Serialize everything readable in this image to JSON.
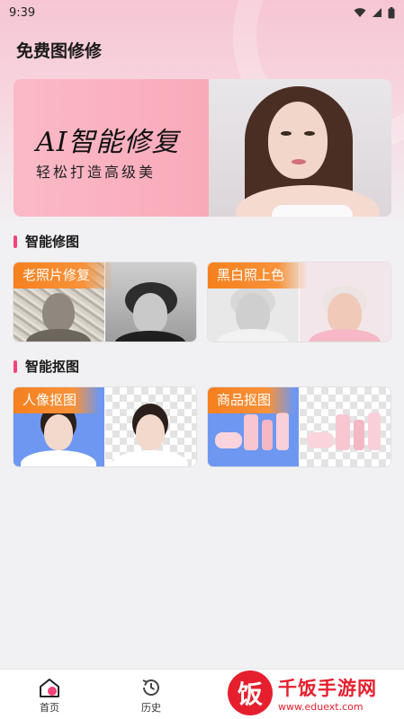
{
  "status_bar": {
    "time": "9:39"
  },
  "app_title": "免费图修修",
  "banner": {
    "title": "AI智能修复",
    "subtitle": "轻松打造高级美"
  },
  "sections": [
    {
      "title": "智能修图",
      "cards": [
        {
          "label": "老照片修复"
        },
        {
          "label": "黑白照上色"
        }
      ]
    },
    {
      "title": "智能抠图",
      "cards": [
        {
          "label": "人像抠图"
        },
        {
          "label": "商品抠图"
        }
      ]
    }
  ],
  "bottom_nav": [
    {
      "label": "首页",
      "icon": "home-icon",
      "active": true
    },
    {
      "label": "历史",
      "icon": "history-icon",
      "active": false
    }
  ],
  "watermark": {
    "logo": "饭",
    "name": "千饭手游网",
    "url": "www.eduext.com"
  },
  "colors": {
    "accent": "#f0457a",
    "tag": "#f5801e",
    "watermark": "#e51f2e"
  }
}
